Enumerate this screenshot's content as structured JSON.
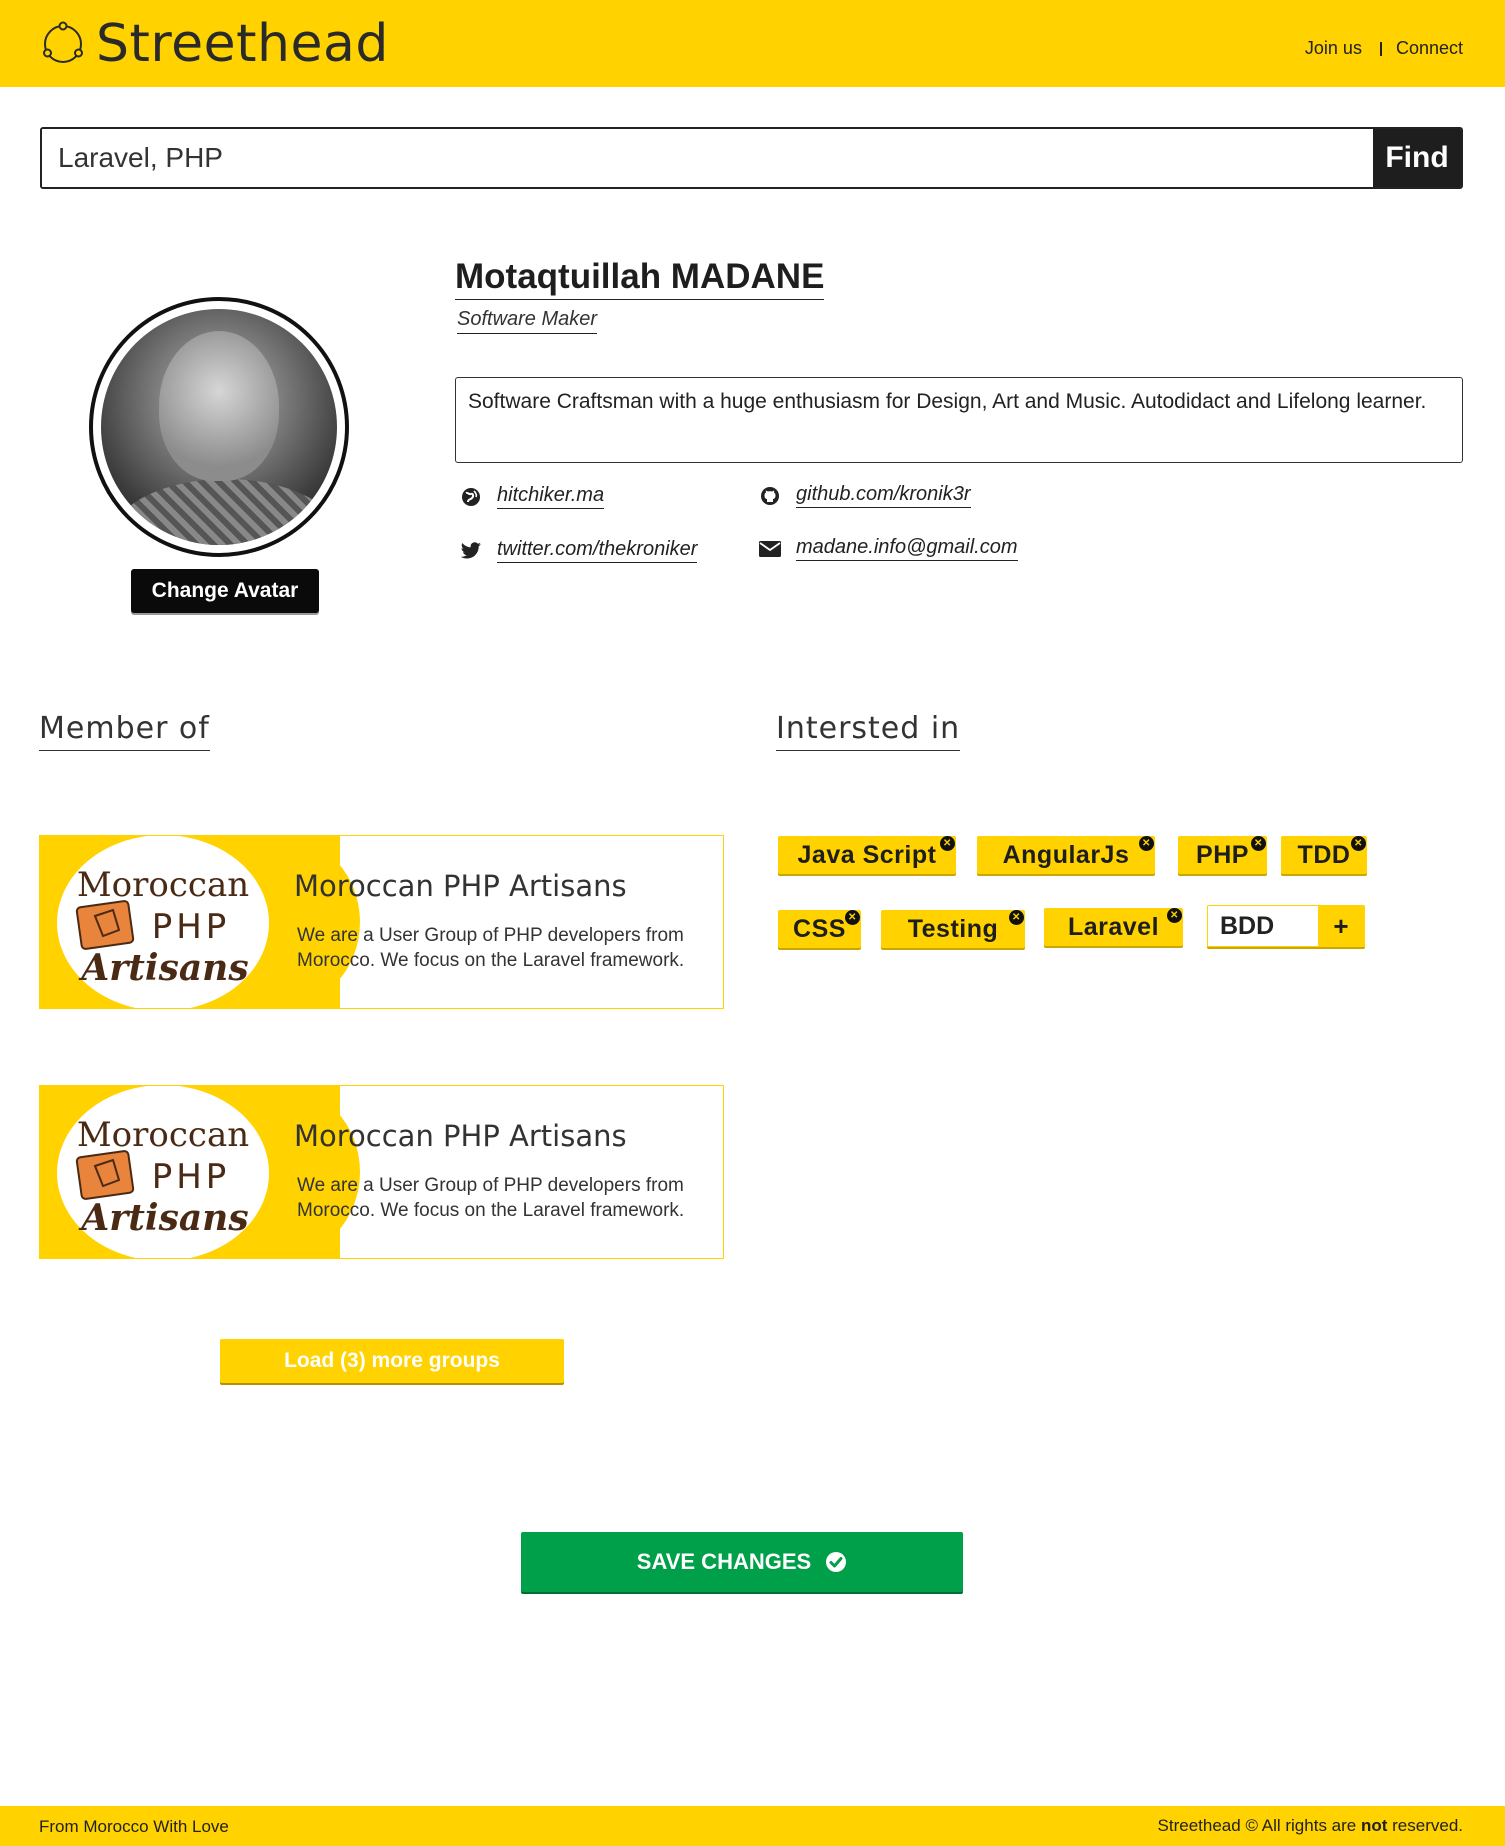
{
  "header": {
    "brand": "Streethead",
    "nav": [
      {
        "label": "Join us"
      },
      {
        "label": "Connect"
      }
    ]
  },
  "search": {
    "value": "Laravel, PHP",
    "button_label": "Find"
  },
  "profile": {
    "name": "Motaqtuillah MADANE",
    "role": "Software Maker",
    "bio": "Software Craftsman with a huge enthusiasm for Design, Art and Music. Autodidact and Lifelong learner.",
    "change_avatar_label": "Change Avatar",
    "links": {
      "website": "hitchiker.ma",
      "github": "github.com/kronik3r",
      "twitter": "twitter.com/thekroniker",
      "email": "madane.info@gmail.com"
    }
  },
  "member_of": {
    "title": "Member of",
    "groups": [
      {
        "name": "Moroccan PHP Artisans",
        "description": "We are a User Group of PHP developers from Morocco. We focus on the Laravel framework.",
        "logo_text": [
          "Moroccan",
          "PHP",
          "Artisans"
        ]
      },
      {
        "name": "Moroccan PHP Artisans",
        "description": "We are a User Group of PHP developers from Morocco. We focus on the Laravel framework.",
        "logo_text": [
          "Moroccan",
          "PHP",
          "Artisans"
        ]
      }
    ],
    "load_more_label": "Load (3) more groups"
  },
  "interested_in": {
    "title": "Intersted in",
    "tags": [
      "Java Script",
      "AngularJs",
      "PHP",
      "TDD",
      "CSS",
      "Testing",
      "Laravel"
    ],
    "new_tag_value": "BDD",
    "add_label": "+"
  },
  "save_label": "SAVE CHANGES",
  "footer": {
    "left": "From Morocco With Love",
    "right_prefix": "Streethead © All rights are ",
    "right_bold": "not",
    "right_suffix": " reserved."
  },
  "colors": {
    "brand_yellow": "#ffd200",
    "save_green": "#00a04a",
    "dark": "#1e1e1e"
  }
}
